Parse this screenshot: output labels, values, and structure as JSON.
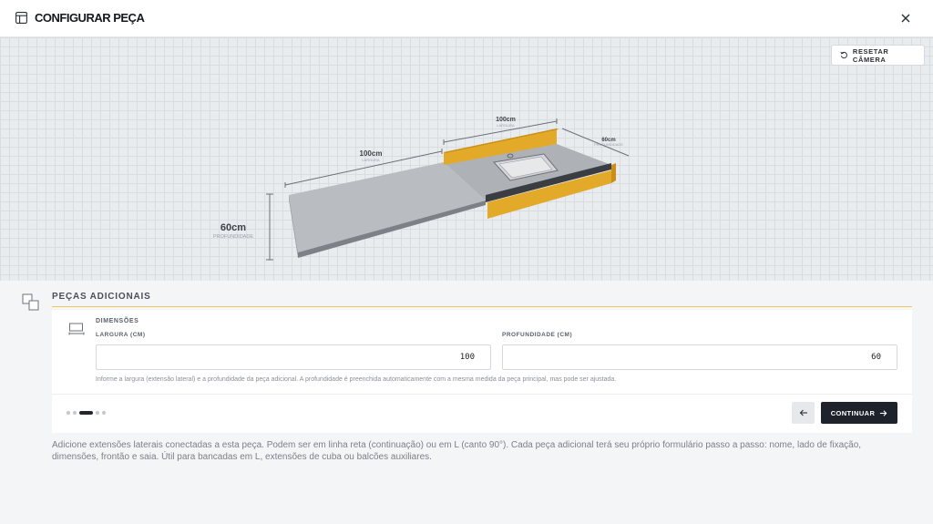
{
  "header": {
    "title": "CONFIGURAR PEÇA",
    "title_icon": "layout-icon",
    "close_icon": "close-icon"
  },
  "viewport": {
    "reset_camera_label": "RESETAR CÂMERA",
    "dimensions": {
      "main_width": "100cm",
      "main_width_caption": "LARGURA",
      "ext_width": "100cm",
      "ext_width_caption": "LARGURA",
      "side_depth": "60cm",
      "side_depth_caption": "PROFUNDIDADE",
      "depth": "60cm",
      "depth_caption": "PROFUNDIDADE"
    },
    "colors": {
      "countertop": "#b9bcc0",
      "backsplash": "#e3a928",
      "edge": "#3a3d42"
    }
  },
  "section": {
    "title": "PEÇAS ADICIONAIS",
    "step_title": "DIMENSÕES",
    "fields": {
      "largura_label": "LARGURA (CM)",
      "largura_value": "100",
      "profundidade_label": "PROFUNDIDADE (CM)",
      "profundidade_value": "60"
    },
    "hint": "Informe a largura (extensão lateral) e a profundidade da peça adicional. A profundidade é preenchida automaticamente com a mesma medida da peça principal, mas pode ser ajustada.",
    "steps_total": 5,
    "steps_current": 3,
    "continue_label": "CONTINUAR",
    "accent_color": "#f0c95a"
  },
  "description": "Adicione extensões laterais conectadas a esta peça. Podem ser em linha reta (continuação) ou em L (canto 90°). Cada peça adicional terá seu próprio formulário passo a passo: nome, lado de fixação, dimensões, frontão e saia. Útil para bancadas em L, extensões de cuba ou balcões auxiliares."
}
